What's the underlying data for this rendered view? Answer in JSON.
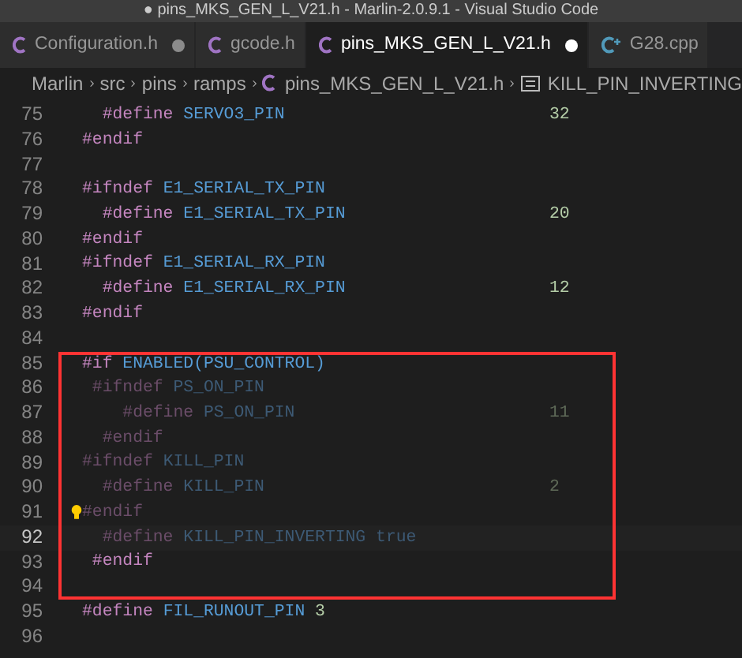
{
  "window": {
    "title": "● pins_MKS_GEN_L_V21.h - Marlin-2.0.9.1 - Visual Studio Code"
  },
  "tabs": [
    {
      "label": "Configuration.h",
      "kind": "c",
      "modified": true,
      "selected": false
    },
    {
      "label": "gcode.h",
      "kind": "c",
      "selected": false
    },
    {
      "label": "pins_MKS_GEN_L_V21.h",
      "kind": "c",
      "modified": true,
      "selected": true
    },
    {
      "label": "G28.cpp",
      "kind": "cpp",
      "selected": false
    }
  ],
  "breadcrumb": [
    {
      "kind": "folder",
      "label": "Marlin"
    },
    {
      "kind": "folder",
      "label": "src"
    },
    {
      "kind": "folder",
      "label": "pins"
    },
    {
      "kind": "folder",
      "label": "ramps"
    },
    {
      "kind": "file",
      "label": "pins_MKS_GEN_L_V21.h"
    },
    {
      "kind": "symbol",
      "label": "KILL_PIN_INVERTING"
    }
  ],
  "code_lines": [
    {
      "number": "75",
      "tokens": [
        {
          "kind": "keyword",
          "text": "  #define"
        },
        {
          "kind": "name",
          "text": "SERVO3_PIN"
        }
      ],
      "value": "32"
    },
    {
      "number": "76",
      "tokens": [
        {
          "kind": "keyword",
          "text": "#endif"
        }
      ]
    },
    {
      "number": "77"
    },
    {
      "number": "78",
      "tokens": [
        {
          "kind": "keyword",
          "text": "#ifndef"
        },
        {
          "kind": "name",
          "text": "E1_SERIAL_TX_PIN"
        }
      ]
    },
    {
      "number": "79",
      "tokens": [
        {
          "kind": "keyword",
          "text": "  #define"
        },
        {
          "kind": "name",
          "text": "E1_SERIAL_TX_PIN"
        }
      ],
      "value": "20"
    },
    {
      "number": "80",
      "tokens": [
        {
          "kind": "keyword",
          "text": "#endif"
        }
      ]
    },
    {
      "number": "81",
      "tokens": [
        {
          "kind": "keyword",
          "text": "#ifndef"
        },
        {
          "kind": "name",
          "text": "E1_SERIAL_RX_PIN"
        }
      ]
    },
    {
      "number": "82",
      "tokens": [
        {
          "kind": "keyword",
          "text": "  #define"
        },
        {
          "kind": "name",
          "text": "E1_SERIAL_RX_PIN"
        }
      ],
      "value": "12"
    },
    {
      "number": "83",
      "tokens": [
        {
          "kind": "keyword",
          "text": "#endif"
        }
      ]
    },
    {
      "number": "84"
    },
    {
      "number": "85",
      "tokens": [
        {
          "kind": "keyword",
          "text": "#if"
        },
        {
          "kind": "name",
          "text": "ENABLED(PSU_CONTROL)"
        }
      ],
      "boxed": true
    },
    {
      "number": "86",
      "tokens": [
        {
          "kind": "keyword",
          "text": " #ifndef"
        },
        {
          "kind": "name",
          "text": "PS_ON_PIN"
        }
      ],
      "inactive": true,
      "boxed": true
    },
    {
      "number": "87",
      "tokens": [
        {
          "kind": "keyword",
          "text": "    #define"
        },
        {
          "kind": "name",
          "text": "PS_ON_PIN"
        }
      ],
      "value": "11",
      "inactive": true,
      "boxed": true
    },
    {
      "number": "88",
      "tokens": [
        {
          "kind": "keyword",
          "text": "  #endif"
        }
      ],
      "inactive": true,
      "boxed": true
    },
    {
      "number": "89",
      "tokens": [
        {
          "kind": "keyword",
          "text": "#ifndef"
        },
        {
          "kind": "name",
          "text": "KILL_PIN"
        }
      ],
      "inactive": true,
      "boxed": true
    },
    {
      "number": "90",
      "tokens": [
        {
          "kind": "keyword",
          "text": "  #define"
        },
        {
          "kind": "name",
          "text": "KILL_PIN"
        }
      ],
      "value": "2",
      "inactive": true,
      "boxed": true
    },
    {
      "number": "91",
      "tokens": [
        {
          "kind": "keyword",
          "text": "#endif"
        }
      ],
      "inactive": true,
      "boxed": true,
      "lightbulb": true
    },
    {
      "number": "92",
      "tokens": [
        {
          "kind": "keyword",
          "text": "  #define"
        },
        {
          "kind": "name",
          "text": "KILL_PIN_INVERTING"
        },
        {
          "kind": "literal",
          "text": "true"
        }
      ],
      "inactive": true,
      "current": true,
      "boxed": true
    },
    {
      "number": "93",
      "tokens": [
        {
          "kind": "keyword",
          "text": " #endif"
        }
      ],
      "boxed": true
    },
    {
      "number": "94",
      "boxed": true
    },
    {
      "number": "95",
      "tokens": [
        {
          "kind": "keyword",
          "text": "#define"
        },
        {
          "kind": "name",
          "text": "FIL_RUNOUT_PIN"
        },
        {
          "kind": "number",
          "text": "3"
        }
      ]
    },
    {
      "number": "96"
    }
  ]
}
